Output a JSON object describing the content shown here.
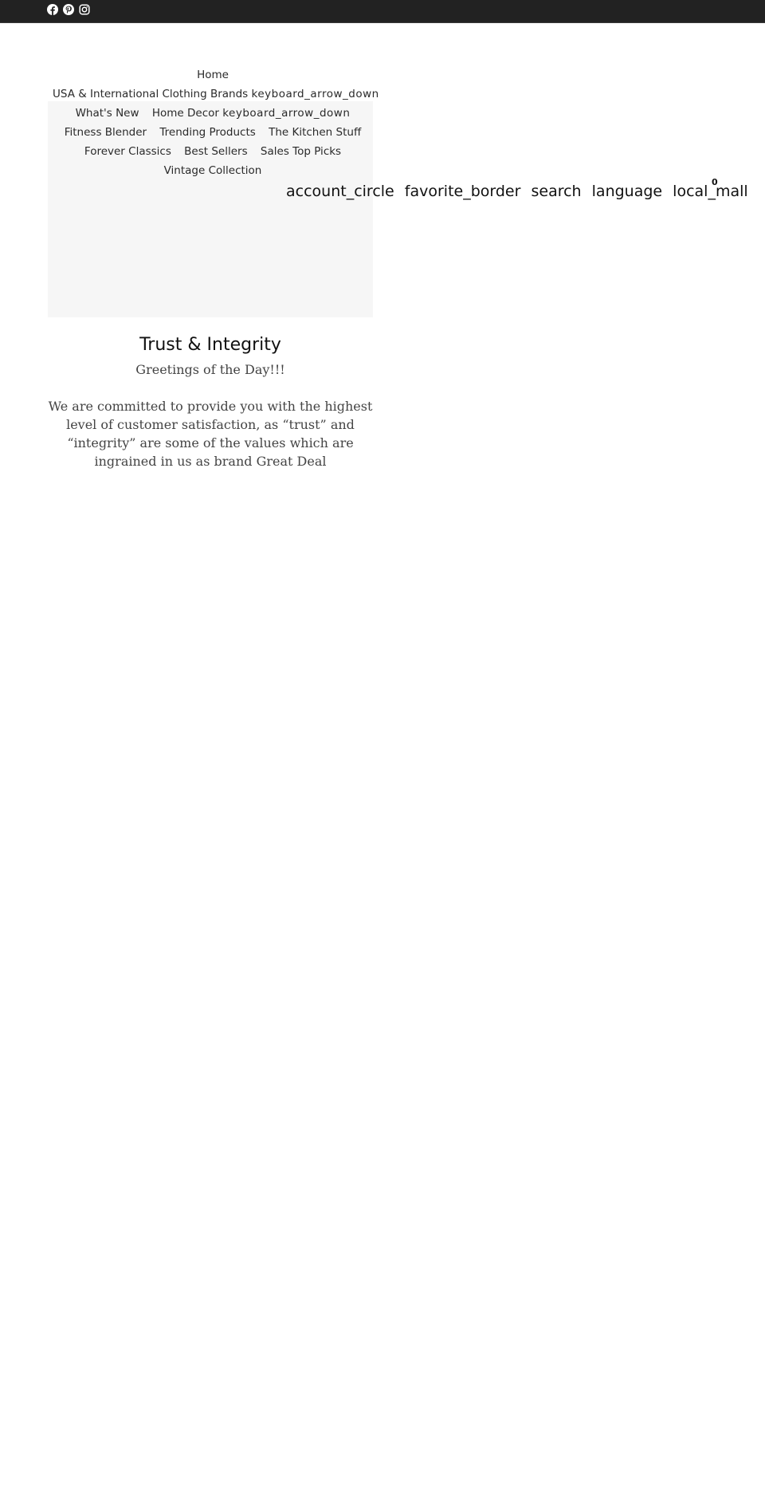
{
  "social": {
    "icons": [
      "facebook-icon",
      "pinterest-icon",
      "instagram-icon"
    ]
  },
  "nav": {
    "home": "Home",
    "usa_intl": "USA & International Clothing Brands",
    "usa_intl_caret": "keyboard_arrow_down",
    "whats_new": "What's New",
    "home_decor": "Home Decor",
    "home_decor_caret": "keyboard_arrow_down",
    "fitness": "Fitness Blender",
    "trending": "Trending Products",
    "kitchen": "The Kitchen Stuff",
    "forever": "Forever Classics",
    "best": "Best Sellers",
    "sales": "Sales Top Picks",
    "vintage": "Vintage Collection"
  },
  "header_icons": {
    "account": "account_circle",
    "favorite": "favorite_border",
    "search": "search",
    "language": "language",
    "cart": "local_mall",
    "cart_count": "0"
  },
  "content": {
    "title": "Trust & Integrity",
    "greeting": "Greetings of the Day!!!",
    "body": "We are committed to provide you with the highest level of customer satisfaction, as “trust” and “integrity” are some of the values which are ingrained in us as brand Great Deal"
  },
  "colors": {
    "topbar": "#222222",
    "image_placeholder": "#f6f6f6",
    "text": "#444444"
  }
}
